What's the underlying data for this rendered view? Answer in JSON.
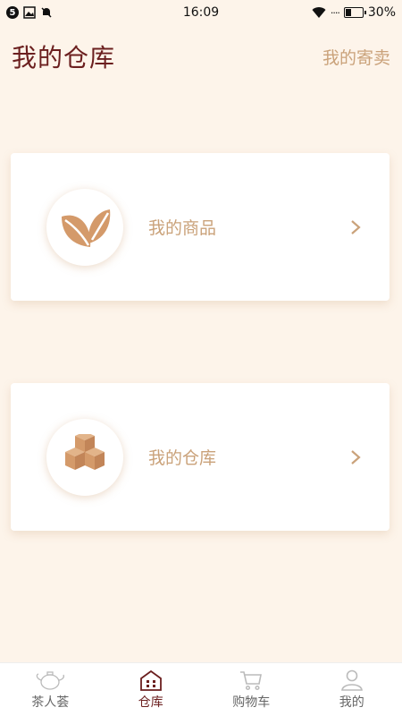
{
  "status": {
    "time": "16:09",
    "battery": "30%",
    "notification_badge": "5",
    "signal_dots": "····"
  },
  "header": {
    "title": "我的仓库",
    "right_link": "我的寄卖"
  },
  "cards": [
    {
      "label": "我的商品",
      "icon": "tea-leaf-icon"
    },
    {
      "label": "我的仓库",
      "icon": "boxes-icon"
    }
  ],
  "tabs": [
    {
      "label": "茶人荟",
      "icon": "teapot-icon",
      "active": false
    },
    {
      "label": "仓库",
      "icon": "warehouse-icon",
      "active": true
    },
    {
      "label": "购物车",
      "icon": "cart-icon",
      "active": false
    },
    {
      "label": "我的",
      "icon": "profile-icon",
      "active": false
    }
  ],
  "colors": {
    "background": "#fdf4ea",
    "title": "#6b1f1f",
    "accent": "#caa27a",
    "icon": "#d49a6a"
  }
}
